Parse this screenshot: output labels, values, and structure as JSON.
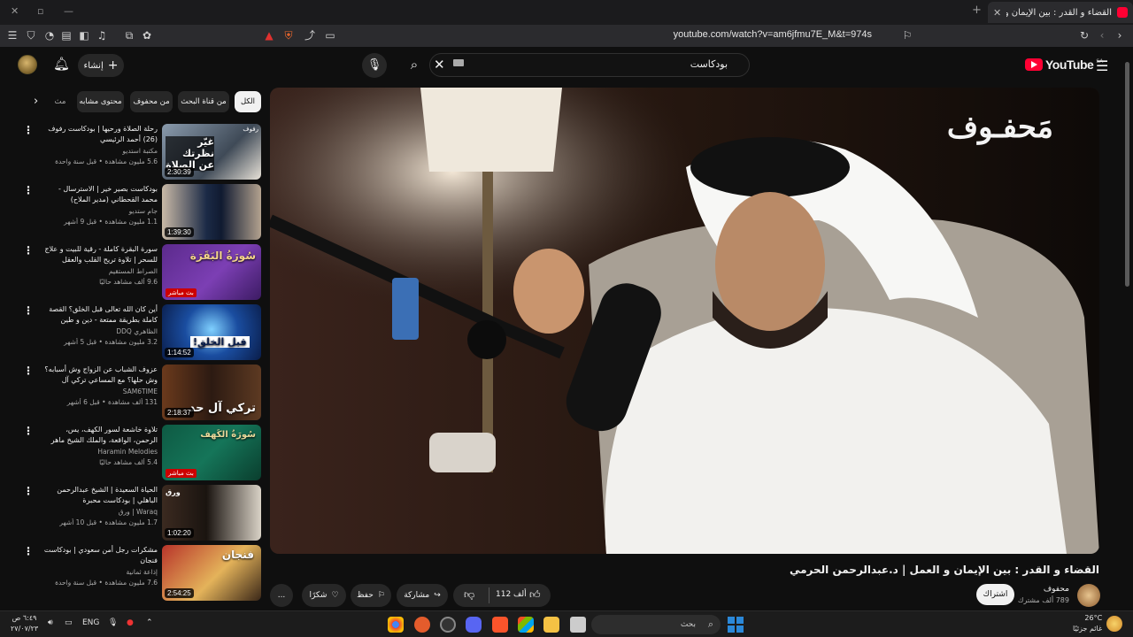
{
  "browser": {
    "tab_title": "القضاء و القدر : بين الإيمان و الع",
    "url": "youtube.com/watch?v=am6jfmu7E_M&t=974s",
    "new_tab": "+"
  },
  "youtube": {
    "logo_word": "YouTube",
    "logo_region": "SA",
    "search_query": "بودكاست",
    "create_label": "إنشاء",
    "chips": [
      "الكل",
      "من قناة البحث",
      "من محفوف",
      "محتوى مشابه",
      "مث"
    ],
    "watermark": "مَحفـوف",
    "video_title": "القضاء و القدر : بين الإيمان و العمل | د.عبدالرحمن الحرمي",
    "channel": {
      "name": "محفوف",
      "subs": "789 ألف مشترك",
      "subscribe": "اشتراك"
    },
    "actions": {
      "likes": "112 ألف",
      "share": "مشاركة",
      "save": "حفظ",
      "thanks": "شكرًا",
      "more": "..."
    }
  },
  "recommendations": [
    {
      "title": "رحلة الصلاة ورحيها | بودكاست رفوف (26) أحمد الرئيسي",
      "channel": "مكتبة استديو",
      "meta": "5.6 مليون مشاهدة • قبل سنة واحدة",
      "duration": "2:30:39",
      "thumb_text": "غيّر نظرتك عن الصلاة",
      "badge": "رفوف"
    },
    {
      "title": "بودكاست بصير خير | الاسترسال - محمد القحطاني (مدير الملاح)",
      "channel": "جام ستديو",
      "meta": "1.1 مليون مشاهدة • قبل 9 أشهر",
      "duration": "1:39:30",
      "thumb_text": "",
      "badge": ""
    },
    {
      "title": "سورة البقرة كاملة - رقية للبيت و علاج للسحر | تلاوة تريح القلب والعقل Surah Al-...",
      "channel": "الصراط المستقيم",
      "meta": "9.6 ألف مشاهد حاليًا",
      "duration": "",
      "thumb_text": "سُورَةُ البَقَرَة",
      "badge": "بث مباشر"
    },
    {
      "title": "أين كان الله تعالى قبل الخلق؟ القصة كاملة بطريقة ممتعة - دين و طين",
      "channel": "الظاهري DDQ",
      "meta": "3.2 مليون مشاهدة • قبل 5 أشهر",
      "duration": "1:14:52",
      "thumb_text": "قبل الخلق!",
      "badge": ""
    },
    {
      "title": "عزوف الشباب عن الزواج وش أسبابه؟ وش حلها؟ مع المساعي تركي آل خصوصية في ...",
      "channel": "SAM6TIME",
      "meta": "131 ألف مشاهدة • قبل 6 أشهر",
      "duration": "2:18:37",
      "thumb_text": "تركي آل حد",
      "badge": ""
    },
    {
      "title": "تلاوة خاشعة لسور الكهف، يس، الرحمن، الواقعة، والملك الشيخ ماهر المعيقلي لتيسير ...",
      "channel": "Haramin Melodies",
      "meta": "5.4 ألف مشاهد حاليًا",
      "duration": "",
      "thumb_text": "سُورَةُ الكَهف",
      "badge": "بث مباشر"
    },
    {
      "title": "الحياة السعيدة | الشيخ عبدالرحمن الباهلي | بودكاست محبرة",
      "channel": "Waraq | ورق",
      "meta": "1.7 مليون مشاهدة • قبل 10 أشهر",
      "duration": "1:02:20",
      "thumb_text": "",
      "badge": "ورق"
    },
    {
      "title": "مشكرات رجل أمن سعودي | بودكاست فنجان",
      "channel": "إذاعة ثمانية",
      "meta": "7.6 مليون مشاهدة • قبل سنة واحدة",
      "duration": "2:54:25",
      "thumb_text": "فنجان",
      "badge": ""
    }
  ],
  "taskbar": {
    "search_placeholder": "بحث",
    "lang": "ENG",
    "time": "٦:٤٩ ص",
    "date": "٢٧/٠٧/٢٣",
    "temp": "26°C",
    "weather": "غائم جزئيًا"
  },
  "colors": {
    "yt_red": "#ff0033",
    "bg": "#0f0f0f",
    "chip_bg": "#272727"
  }
}
